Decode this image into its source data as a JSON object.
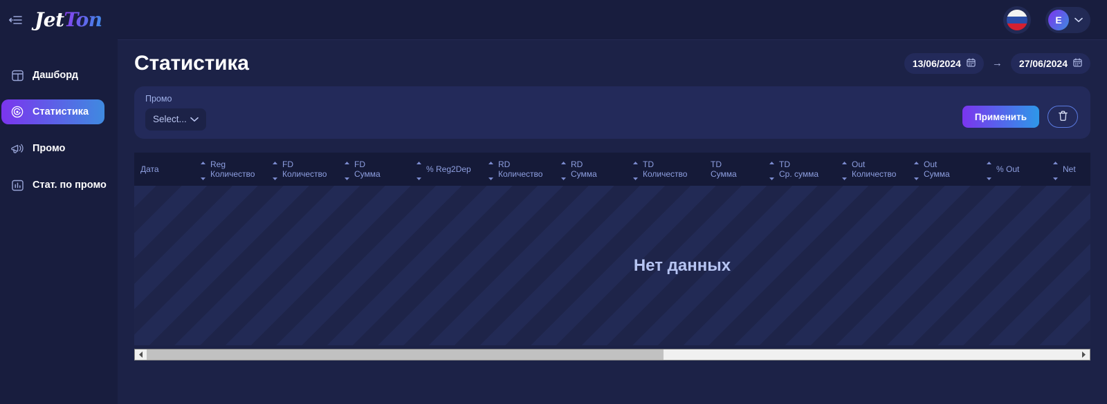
{
  "brand": {
    "logo_part1": "Jet",
    "logo_part2": "Ton",
    "accent_purple": "#7b35ee",
    "accent_blue": "#3f8ae0"
  },
  "sidebar": {
    "collapse_icon": "collapse-sidebar-icon",
    "items": [
      {
        "label": "Дашборд",
        "icon": "dashboard-icon",
        "active": false
      },
      {
        "label": "Статистика",
        "icon": "statistics-icon",
        "active": true
      },
      {
        "label": "Промо",
        "icon": "megaphone-icon",
        "active": false
      },
      {
        "label": "Стат. по промо",
        "icon": "bar-chart-icon",
        "active": false
      }
    ]
  },
  "topbar": {
    "language_flag": "russia-flag-icon",
    "avatar_initial": "E",
    "chevron_icon": "chevron-down-icon"
  },
  "page": {
    "title": "Статистика"
  },
  "date_range": {
    "start": "13/06/2024",
    "end": "27/06/2024",
    "arrow": "→",
    "calendar_icon": "calendar-icon"
  },
  "filters": {
    "promo_label": "Промо",
    "promo_value": "Select...",
    "apply_label": "Применить",
    "delete_icon": "trash-icon"
  },
  "table": {
    "columns": [
      {
        "line1": "Дата",
        "line2": "",
        "sortable": false
      },
      {
        "line1": "Reg",
        "line2": "Количество",
        "sortable": true
      },
      {
        "line1": "FD",
        "line2": "Количество",
        "sortable": true
      },
      {
        "line1": "FD",
        "line2": "Сумма",
        "sortable": true
      },
      {
        "line1": "% Reg2Dep",
        "line2": "",
        "sortable": true
      },
      {
        "line1": "RD",
        "line2": "Количество",
        "sortable": true
      },
      {
        "line1": "RD",
        "line2": "Сумма",
        "sortable": true
      },
      {
        "line1": "TD",
        "line2": "Количество",
        "sortable": true
      },
      {
        "line1": "TD",
        "line2": "Сумма",
        "sortable": true
      },
      {
        "line1": "TD",
        "line2": "Ср. сумма",
        "sortable": true
      },
      {
        "line1": "Out",
        "line2": "Количество",
        "sortable": true
      },
      {
        "line1": "Out",
        "line2": "Сумма",
        "sortable": true
      },
      {
        "line1": "% Out",
        "line2": "",
        "sortable": true
      },
      {
        "line1": "Net",
        "line2": "",
        "sortable": true
      }
    ],
    "rows": [],
    "empty_message": "Нет данных"
  },
  "scrollbar": {
    "left_arrow": "scroll-left-icon",
    "right_arrow": "scroll-right-icon"
  }
}
